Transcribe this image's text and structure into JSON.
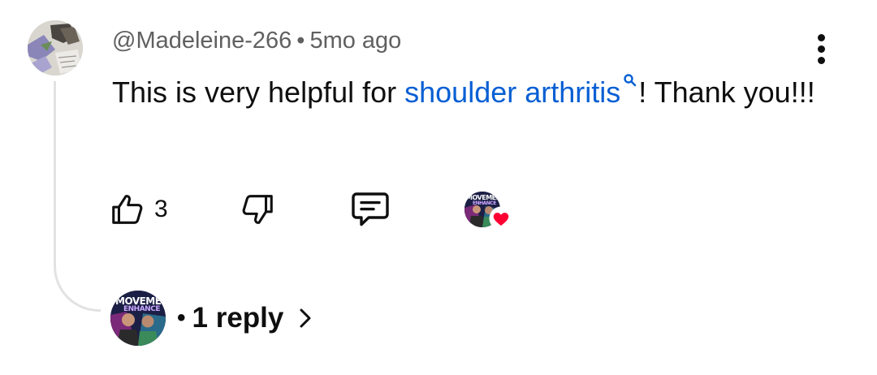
{
  "comment": {
    "author": "@Madeleine-266",
    "separator": "•",
    "timestamp": "5mo ago",
    "text_before": "This is very helpful for ",
    "link_text": "shoulder arthritis",
    "text_after": "!  Thank you!!!",
    "like_count": "3"
  },
  "replies": {
    "separator": "•",
    "label": "1 reply"
  },
  "creator_avatar": {
    "brand_line1": "MOVEMENT",
    "brand_line2": "ENHANCE"
  },
  "icons": {
    "menu": "more-vert-icon",
    "like": "thumbs-up-icon",
    "dislike": "thumbs-down-icon",
    "reply": "comment-icon",
    "creator_heart": "heart-icon",
    "search": "search-icon",
    "chevron": "chevron-right-icon"
  },
  "colors": {
    "link": "#065fd4",
    "meta": "#606060",
    "heart": "#ff0033"
  }
}
